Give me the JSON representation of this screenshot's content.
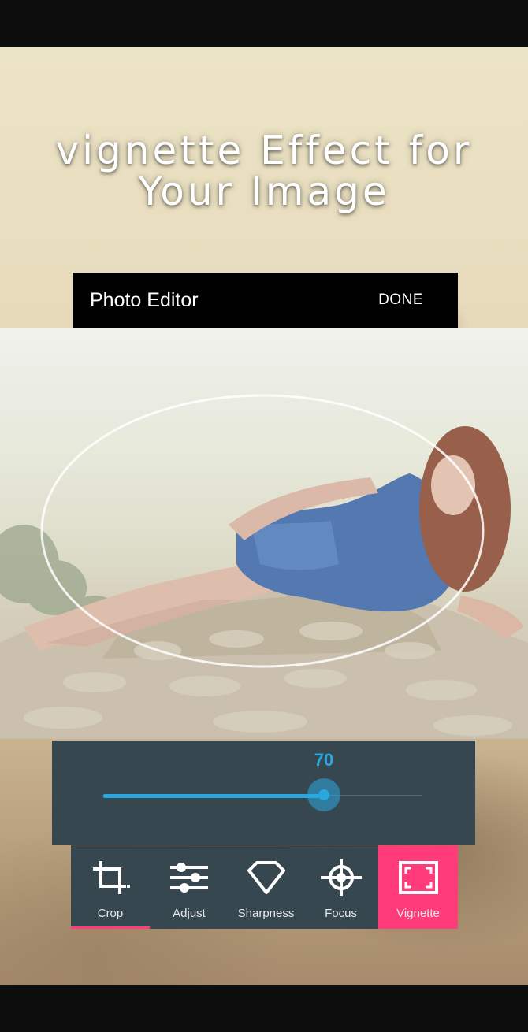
{
  "promo": {
    "headline_line1": "vignette Effect for",
    "headline_line2": "Your Image"
  },
  "action_bar": {
    "title": "Photo Editor",
    "done_label": "DONE"
  },
  "slider": {
    "value_label": "70",
    "value": 70,
    "max": 100,
    "accent_color": "#29a8e0"
  },
  "toolbar": {
    "items": [
      {
        "label": "Crop",
        "icon": "crop-icon",
        "active": false
      },
      {
        "label": "Adjust",
        "icon": "sliders-icon",
        "active": false
      },
      {
        "label": "Sharpness",
        "icon": "diamond-icon",
        "active": false
      },
      {
        "label": "Focus",
        "icon": "crosshair-icon",
        "active": false
      },
      {
        "label": "Vignette",
        "icon": "vignette-frame-icon",
        "active": true
      }
    ],
    "background_color": "#37474f",
    "active_color": "#ff3b7a"
  }
}
